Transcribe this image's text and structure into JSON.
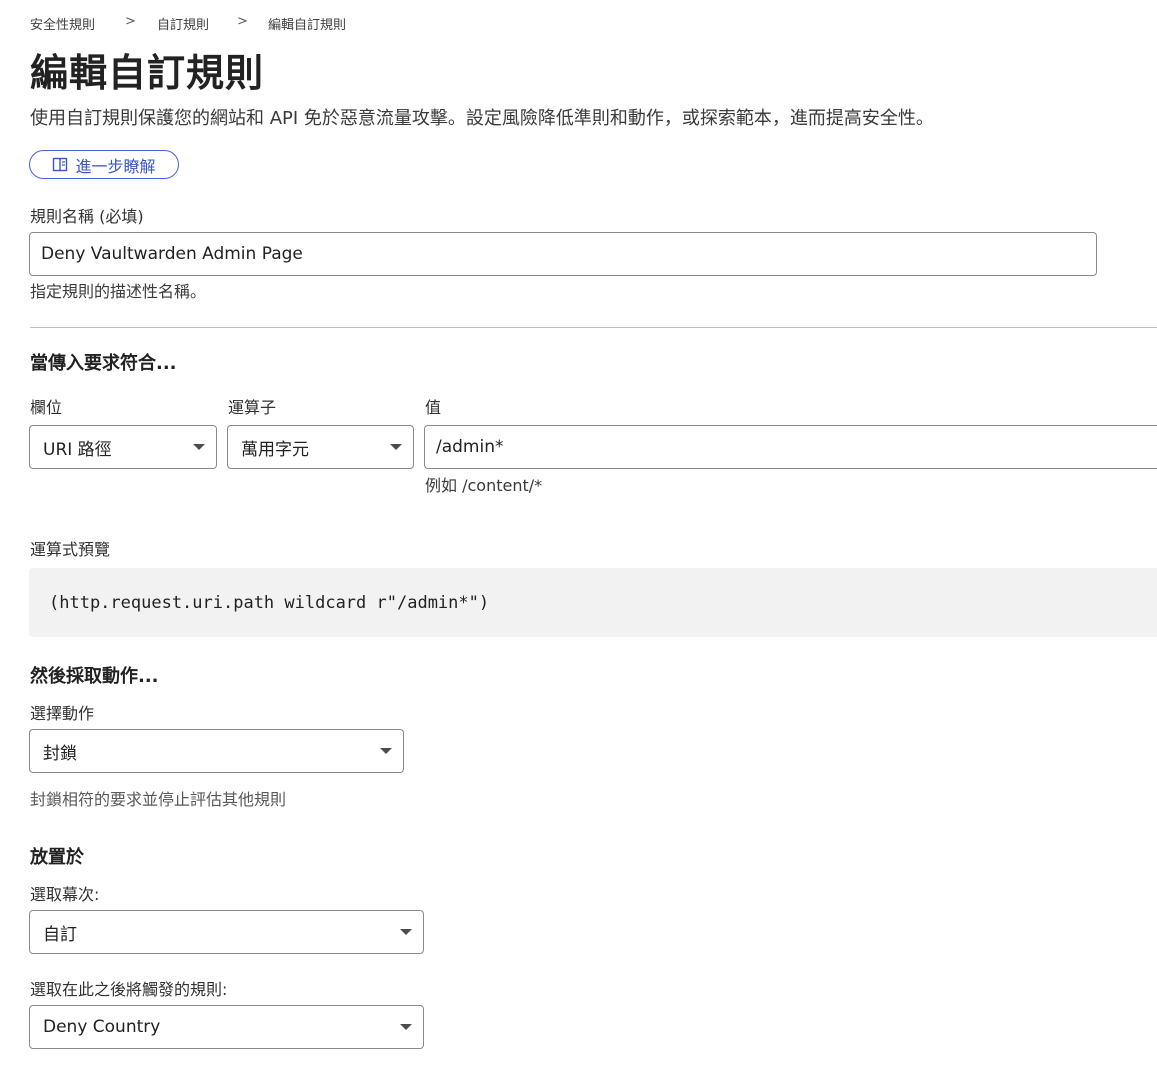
{
  "breadcrumb": {
    "items": [
      "安全性規則",
      "自訂規則",
      "編輯自訂規則"
    ],
    "separator": ">"
  },
  "header": {
    "title": "編輯自訂規則",
    "description": "使用自訂規則保護您的網站和 API 免於惡意流量攻擊。設定風險降低準則和動作，或探索範本，進而提高安全性。",
    "learn_more_label": "進一步瞭解",
    "learn_more_icon": "book-icon"
  },
  "rule_name": {
    "label": "規則名稱 (必填)",
    "value": "Deny Vaultwarden Admin Page",
    "helper": "指定規則的描述性名稱。"
  },
  "match": {
    "section_title": "當傳入要求符合...",
    "field_label": "欄位",
    "field_value": "URI 路徑",
    "operator_label": "運算子",
    "operator_value": "萬用字元",
    "value_label": "值",
    "value_value": "/admin*",
    "value_helper": "例如 /content/*"
  },
  "expression": {
    "label": "運算式預覽",
    "code": "(http.request.uri.path wildcard r\"/admin*\")"
  },
  "action": {
    "section_title": "然後採取動作...",
    "select_label": "選擇動作",
    "select_value": "封鎖",
    "helper": "封鎖相符的要求並停止評估其他規則"
  },
  "placement": {
    "section_title": "放置於",
    "order_label": "選取幕次:",
    "order_value": "自訂",
    "after_label": "選取在此之後將觸發的規則:",
    "after_value": "Deny Country"
  },
  "colors": {
    "accent": "#3a55c9",
    "text": "#313131",
    "border": "#8a8a8a",
    "code_bg": "#f2f2f2"
  }
}
